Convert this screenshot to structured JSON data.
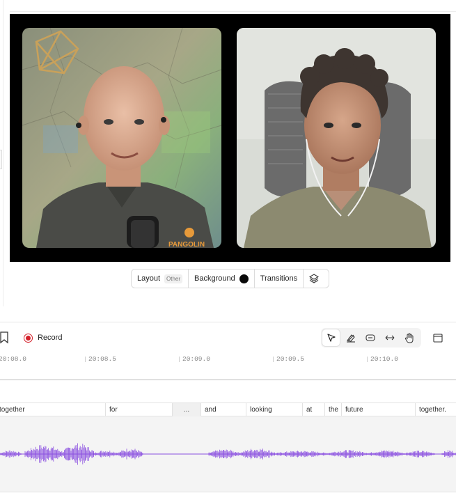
{
  "scene_toolbar": {
    "layout_label": "Layout",
    "layout_value": "Other",
    "background_label": "Background",
    "background_color": "#0a0a0a",
    "transitions_label": "Transitions",
    "layers_icon": "layers-icon"
  },
  "speakers": {
    "left": {
      "shirt_logo": "PANGOLIN",
      "background": "map wall"
    },
    "right": {
      "background": "office chair"
    }
  },
  "timeline": {
    "record_label": "Record",
    "record_color": "#d4202a",
    "tools": [
      "pointer-icon",
      "eraser-icon",
      "trim-icon",
      "stretch-icon",
      "hand-icon"
    ],
    "ruler_ticks": [
      "20:08.0",
      "20:08.5",
      "20:09.0",
      "20:09.5",
      "20:10.0"
    ],
    "waveform_color": "#8a4fe0",
    "words": [
      "together",
      "for",
      "...",
      "and",
      "looking",
      "at",
      "the",
      "future",
      "together."
    ]
  }
}
